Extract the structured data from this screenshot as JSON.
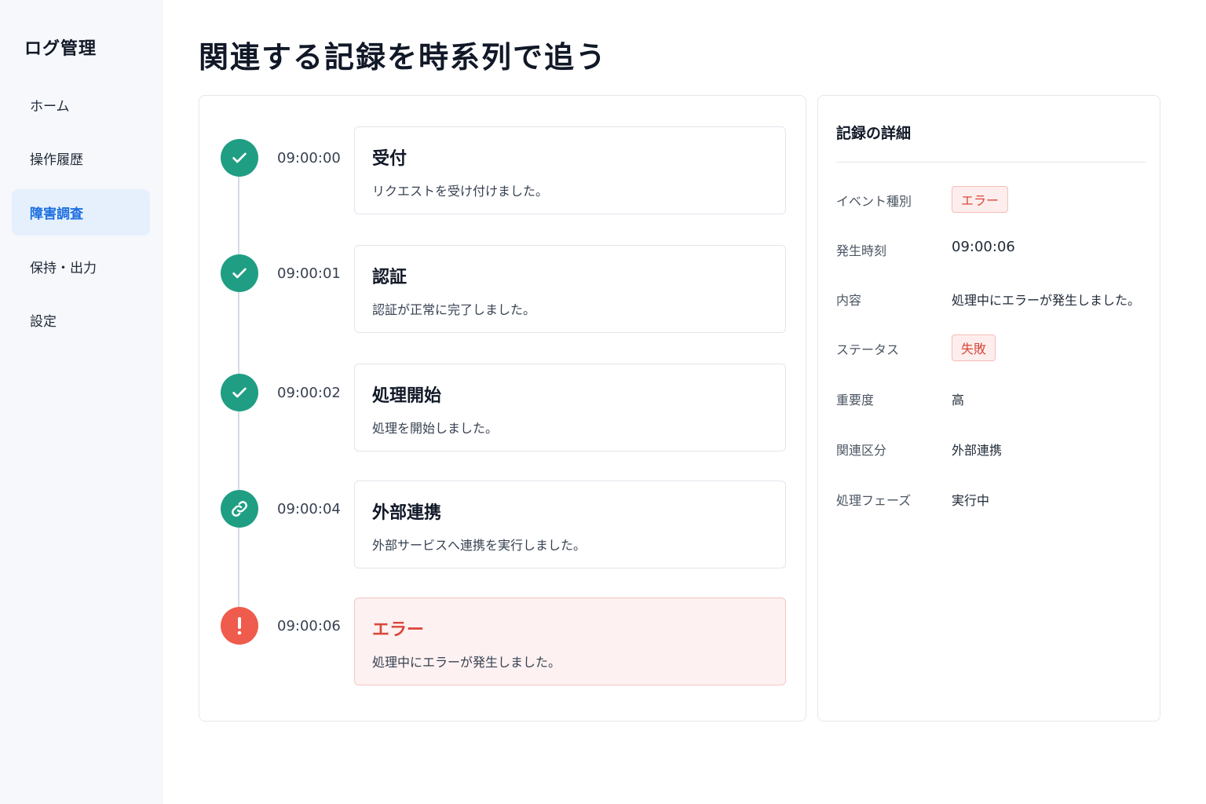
{
  "sidebar": {
    "brand": "ログ管理",
    "items": [
      {
        "label": "ホーム"
      },
      {
        "label": "操作履歴"
      },
      {
        "label": "障害調査",
        "active": true
      },
      {
        "label": "保持・出力"
      },
      {
        "label": "設定"
      }
    ]
  },
  "page": {
    "title": "関連する記録を時系列で追う"
  },
  "timeline": {
    "events": [
      {
        "time": "09:00:00",
        "title": "受付",
        "description": "リクエストを受け付けました。",
        "icon": "check-icon",
        "status": "success"
      },
      {
        "time": "09:00:01",
        "title": "認証",
        "description": "認証が正常に完了しました。",
        "icon": "check-icon",
        "status": "success"
      },
      {
        "time": "09:00:02",
        "title": "処理開始",
        "description": "処理を開始しました。",
        "icon": "check-icon",
        "status": "success"
      },
      {
        "time": "09:00:04",
        "title": "外部連携",
        "description": "外部サービスへ連携を実行しました。",
        "icon": "link-icon",
        "status": "success"
      },
      {
        "time": "09:00:06",
        "title": "エラー",
        "description": "処理中にエラーが発生しました。",
        "icon": "exclamation-icon",
        "status": "error"
      }
    ]
  },
  "detail": {
    "title": "記録の詳細",
    "fields": [
      {
        "label": "イベント種別",
        "value": "エラー"
      },
      {
        "label": "発生時刻",
        "value": "09:00:06"
      },
      {
        "label": "内容",
        "value": "処理中にエラーが発生しました。"
      },
      {
        "label": "ステータス",
        "value": "失敗"
      },
      {
        "label": "重要度",
        "value": "高"
      },
      {
        "label": "関連区分",
        "value": "外部連携"
      },
      {
        "label": "処理フェーズ",
        "value": "実行中"
      }
    ]
  },
  "colors": {
    "accent": "#1d6fe0",
    "success": "#1f9e83",
    "error": "#ef5b4c",
    "error_text": "#d9473a"
  }
}
